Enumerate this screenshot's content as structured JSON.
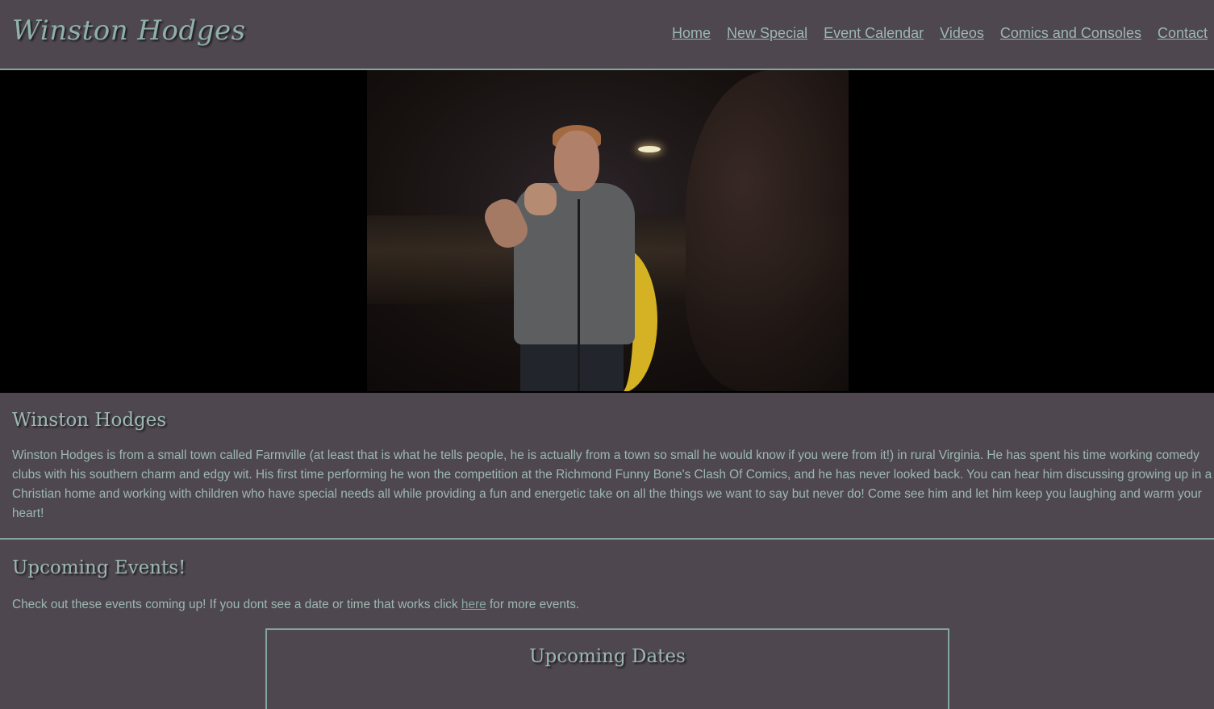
{
  "header": {
    "logo": "Winston Hodges",
    "nav": [
      {
        "label": "Home"
      },
      {
        "label": "New Special"
      },
      {
        "label": "Event Calendar"
      },
      {
        "label": "Videos"
      },
      {
        "label": "Comics and Consoles"
      },
      {
        "label": "Contact"
      }
    ]
  },
  "bio": {
    "title": "Winston Hodges",
    "text": "Winston Hodges is from a small town called Farmville (at least that is what he tells people, he is actually from a town so small he would know if you were from it!) in rural Virginia. He has spent his time working comedy clubs with his southern charm and edgy wit. His first time performing he won the competition at the Richmond Funny Bone's Clash Of Comics, and he has never looked back. You can hear him discussing growing up in a Christian home and working with children who have special needs all while providing a fun and energetic take on all the things we want to say but never do! Come see him and let him keep you laughing and warm your heart!"
  },
  "events": {
    "title": "Upcoming Events!",
    "text_before": "Check out these events coming up! If you dont see a date or time that works click ",
    "link": "here",
    "text_after": " for more events.",
    "box_title": "Upcoming Dates"
  },
  "colors": {
    "background": "#4e4750",
    "accent": "#9cb8b0",
    "border": "#84a59c"
  }
}
